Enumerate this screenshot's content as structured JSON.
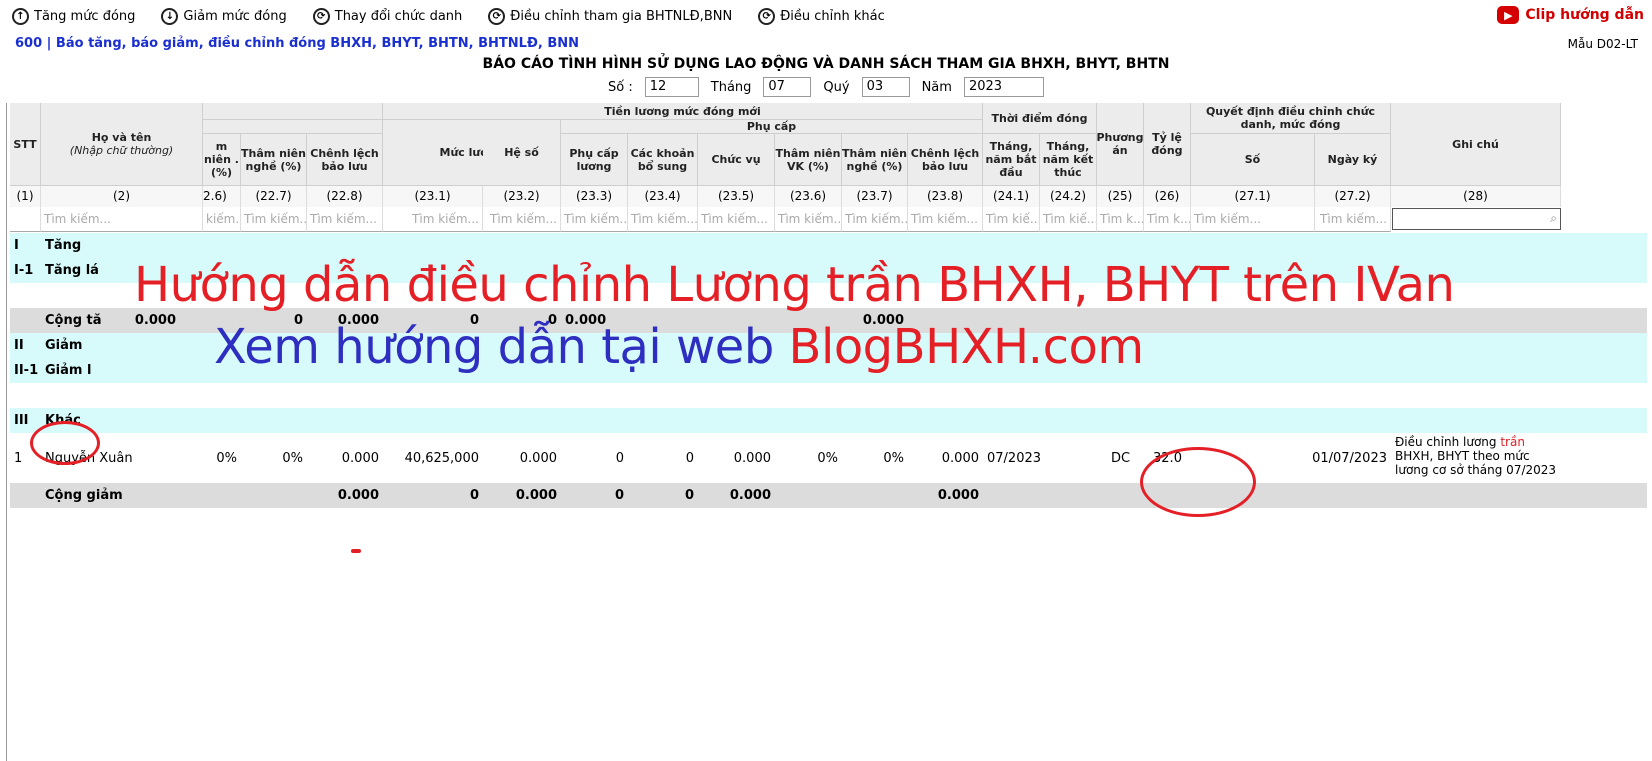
{
  "toolbar": {
    "items": [
      {
        "label": "Tăng mức đóng",
        "icon": "up-arrow-icon"
      },
      {
        "label": "Giảm mức đóng",
        "icon": "down-arrow-icon"
      },
      {
        "label": "Thay đổi chức danh",
        "icon": "refresh-icon"
      },
      {
        "label": "Điều chỉnh tham gia BHTNLĐ,BNN",
        "icon": "refresh-icon"
      },
      {
        "label": "Điều chỉnh khác",
        "icon": "refresh-icon"
      }
    ],
    "clip_label": "Clip hướng dẫn"
  },
  "form": {
    "code_title": "600 | Báo tăng, báo giảm, điều chỉnh đóng BHXH, BHYT, BHTN, BHTNLĐ, BNN",
    "form_no": "Mẫu D02-LT",
    "report_title": "BÁO CÁO TÌNH HÌNH SỬ DỤNG LAO ĐỘNG VÀ DANH SÁCH THAM GIA BHXH, BHYT, BHTN"
  },
  "params": {
    "so_label": "Số :",
    "so_value": "12",
    "thang_label": "Tháng",
    "thang_value": "07",
    "quy_label": "Quý",
    "quy_value": "03",
    "nam_label": "Năm",
    "nam_value": "2023"
  },
  "headers": {
    "stt": "STT",
    "ho_ten": "Họ và tên",
    "ho_ten_note": "(Nhập chữ thường)",
    "tien_luong_moi": "Tiền lương mức đóng mới",
    "phu_cap": "Phụ cấp",
    "thoi_diem_dong": "Thời điểm đóng",
    "quyet_dinh": "Quyết định điều chỉnh chức danh, mức đóng",
    "ghi_chu": "Ghi chú",
    "c_226": "m niên . (%)",
    "c_227": "Thâm niên nghề (%)",
    "c_228": "Chênh lệch bảo lưu",
    "c_231": "Mức lương",
    "c_232": "Hệ số",
    "c_233": "Phụ cấp lương",
    "c_234": "Các khoản bổ sung",
    "c_235": "Chức vụ",
    "c_236": "Thâm niên VK (%)",
    "c_237": "Thâm niên nghề (%)",
    "c_238": "Chênh lệch bảo lưu",
    "c_241": "Tháng, năm bắt đầu",
    "c_242": "Tháng, năm kết thúc",
    "c_25": "Phương án",
    "c_26": "Tỷ lệ đóng",
    "c_271": "Số",
    "c_272": "Ngày ký"
  },
  "col_numbers": [
    "(1)",
    "(2)",
    "2.6)",
    "(22.7)",
    "(22.8)",
    "(23.1)",
    "(23.2)",
    "(23.3)",
    "(23.4)",
    "(23.5)",
    "(23.6)",
    "(23.7)",
    "(23.8)",
    "(24.1)",
    "(24.2)",
    "(25)",
    "(26)",
    "(27.1)",
    "(27.2)",
    "(28)"
  ],
  "filter_placeholder": "Tìm kiếm...",
  "filter_texts": [
    "",
    "Tìm kiếm...",
    "kiếm...",
    "Tìm kiếm...",
    "Tìm kiếm...",
    "Tìm kiếm...",
    "Tìm kiếm...",
    "Tìm kiếm...",
    "Tìm kiếm...",
    "Tìm kiếm...",
    "Tìm kiếm...",
    "Tìm kiếm...",
    "Tìm kiếm...",
    "Tìm kiế...",
    "Tìm kiế...",
    "Tìm k...",
    "Tìm k...",
    "Tìm kiếm...",
    "Tìm kiếm..."
  ],
  "rows": {
    "r1": {
      "stt": "I",
      "name": "Tăng"
    },
    "r2": {
      "stt": "I-1",
      "name": "Tăng lá"
    },
    "r4": {
      "name": "Cộng tă",
      "v1": "0.000",
      "v2": "0",
      "v3": "0.000",
      "v4": "0",
      "v5": "0",
      "v6": "0.000",
      "v7": "0.000"
    },
    "r5": {
      "stt": "II",
      "name": "Giảm"
    },
    "r6": {
      "stt": "II-1",
      "name": "Giảm l"
    },
    "r8": {
      "stt": "III",
      "name": "Khác"
    },
    "r9": {
      "stt": "1",
      "name": "Nguyễn Xuân",
      "c226": "0%",
      "c227": "0%",
      "c228": "0.000",
      "c231": "40,625,000",
      "c232": "0.000",
      "c233": "0",
      "c234": "0",
      "c235": "0.000",
      "c236": "0%",
      "c237": "0%",
      "c238": "0.000",
      "c241": "07/2023",
      "c25": "DC",
      "c26": "32.0",
      "c272": "01/07/2023",
      "note_a": "Điều chỉnh lương ",
      "note_b": "trần",
      "note_c": " BHXH, BHYT theo mức lương cơ sở tháng 07/2023"
    },
    "r10": {
      "name": "Cộng giảm",
      "v228": "0.000",
      "v231": "0",
      "v232": "0.000",
      "v233": "0",
      "v234": "0",
      "v235": "0.000",
      "v238": "0.000"
    }
  },
  "overlay": {
    "line1": "Hướng dẫn điều chỉnh Lương trần BHXH, BHYT trên IVan",
    "line2_a": "Xem hướng dẫn tại web ",
    "line2_b": "BlogBHXH.com"
  },
  "colors": {
    "accent_red": "#e42026",
    "title_blue": "#1a2fd0",
    "overlay_blue": "#2e2ec0",
    "row_cyan": "#d7fafb",
    "row_gray": "#dcdcdc"
  }
}
